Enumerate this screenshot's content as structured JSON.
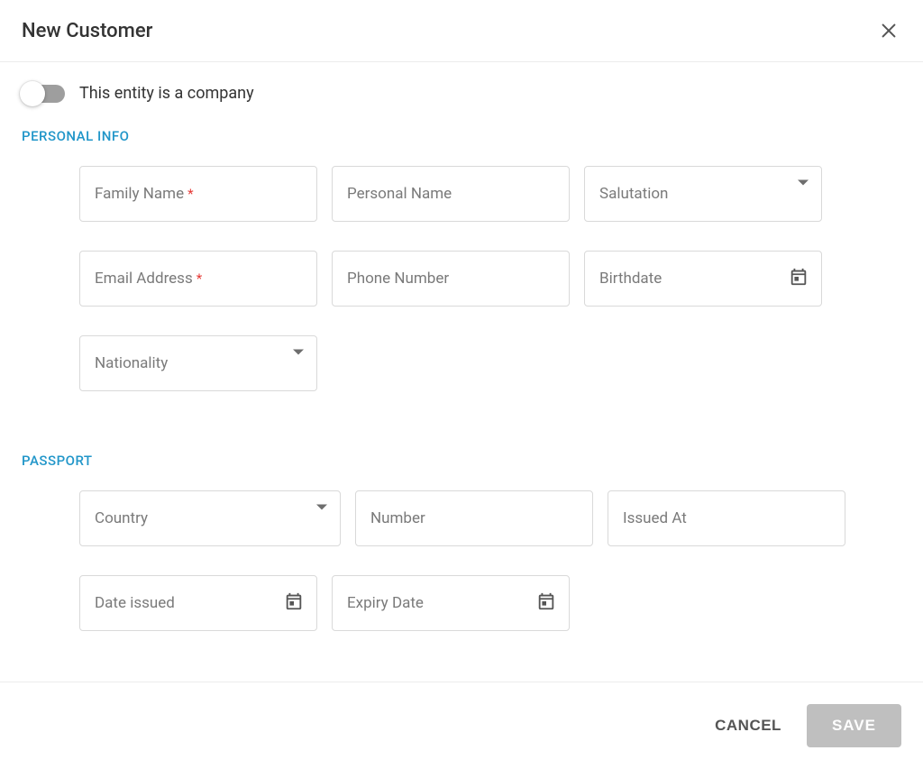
{
  "header": {
    "title": "New Customer"
  },
  "toggle": {
    "label": "This entity is a company"
  },
  "sections": {
    "personal": {
      "label": "PERSONAL INFO"
    },
    "passport": {
      "label": "PASSPORT"
    }
  },
  "fields": {
    "family_name": "Family Name",
    "personal_name": "Personal Name",
    "salutation": "Salutation",
    "email": "Email Address",
    "phone": "Phone Number",
    "birthdate": "Birthdate",
    "nationality": "Nationality",
    "country": "Country",
    "number": "Number",
    "issued_at": "Issued At",
    "date_issued": "Date issued",
    "expiry_date": "Expiry Date"
  },
  "buttons": {
    "cancel": "CANCEL",
    "save": "SAVE"
  }
}
